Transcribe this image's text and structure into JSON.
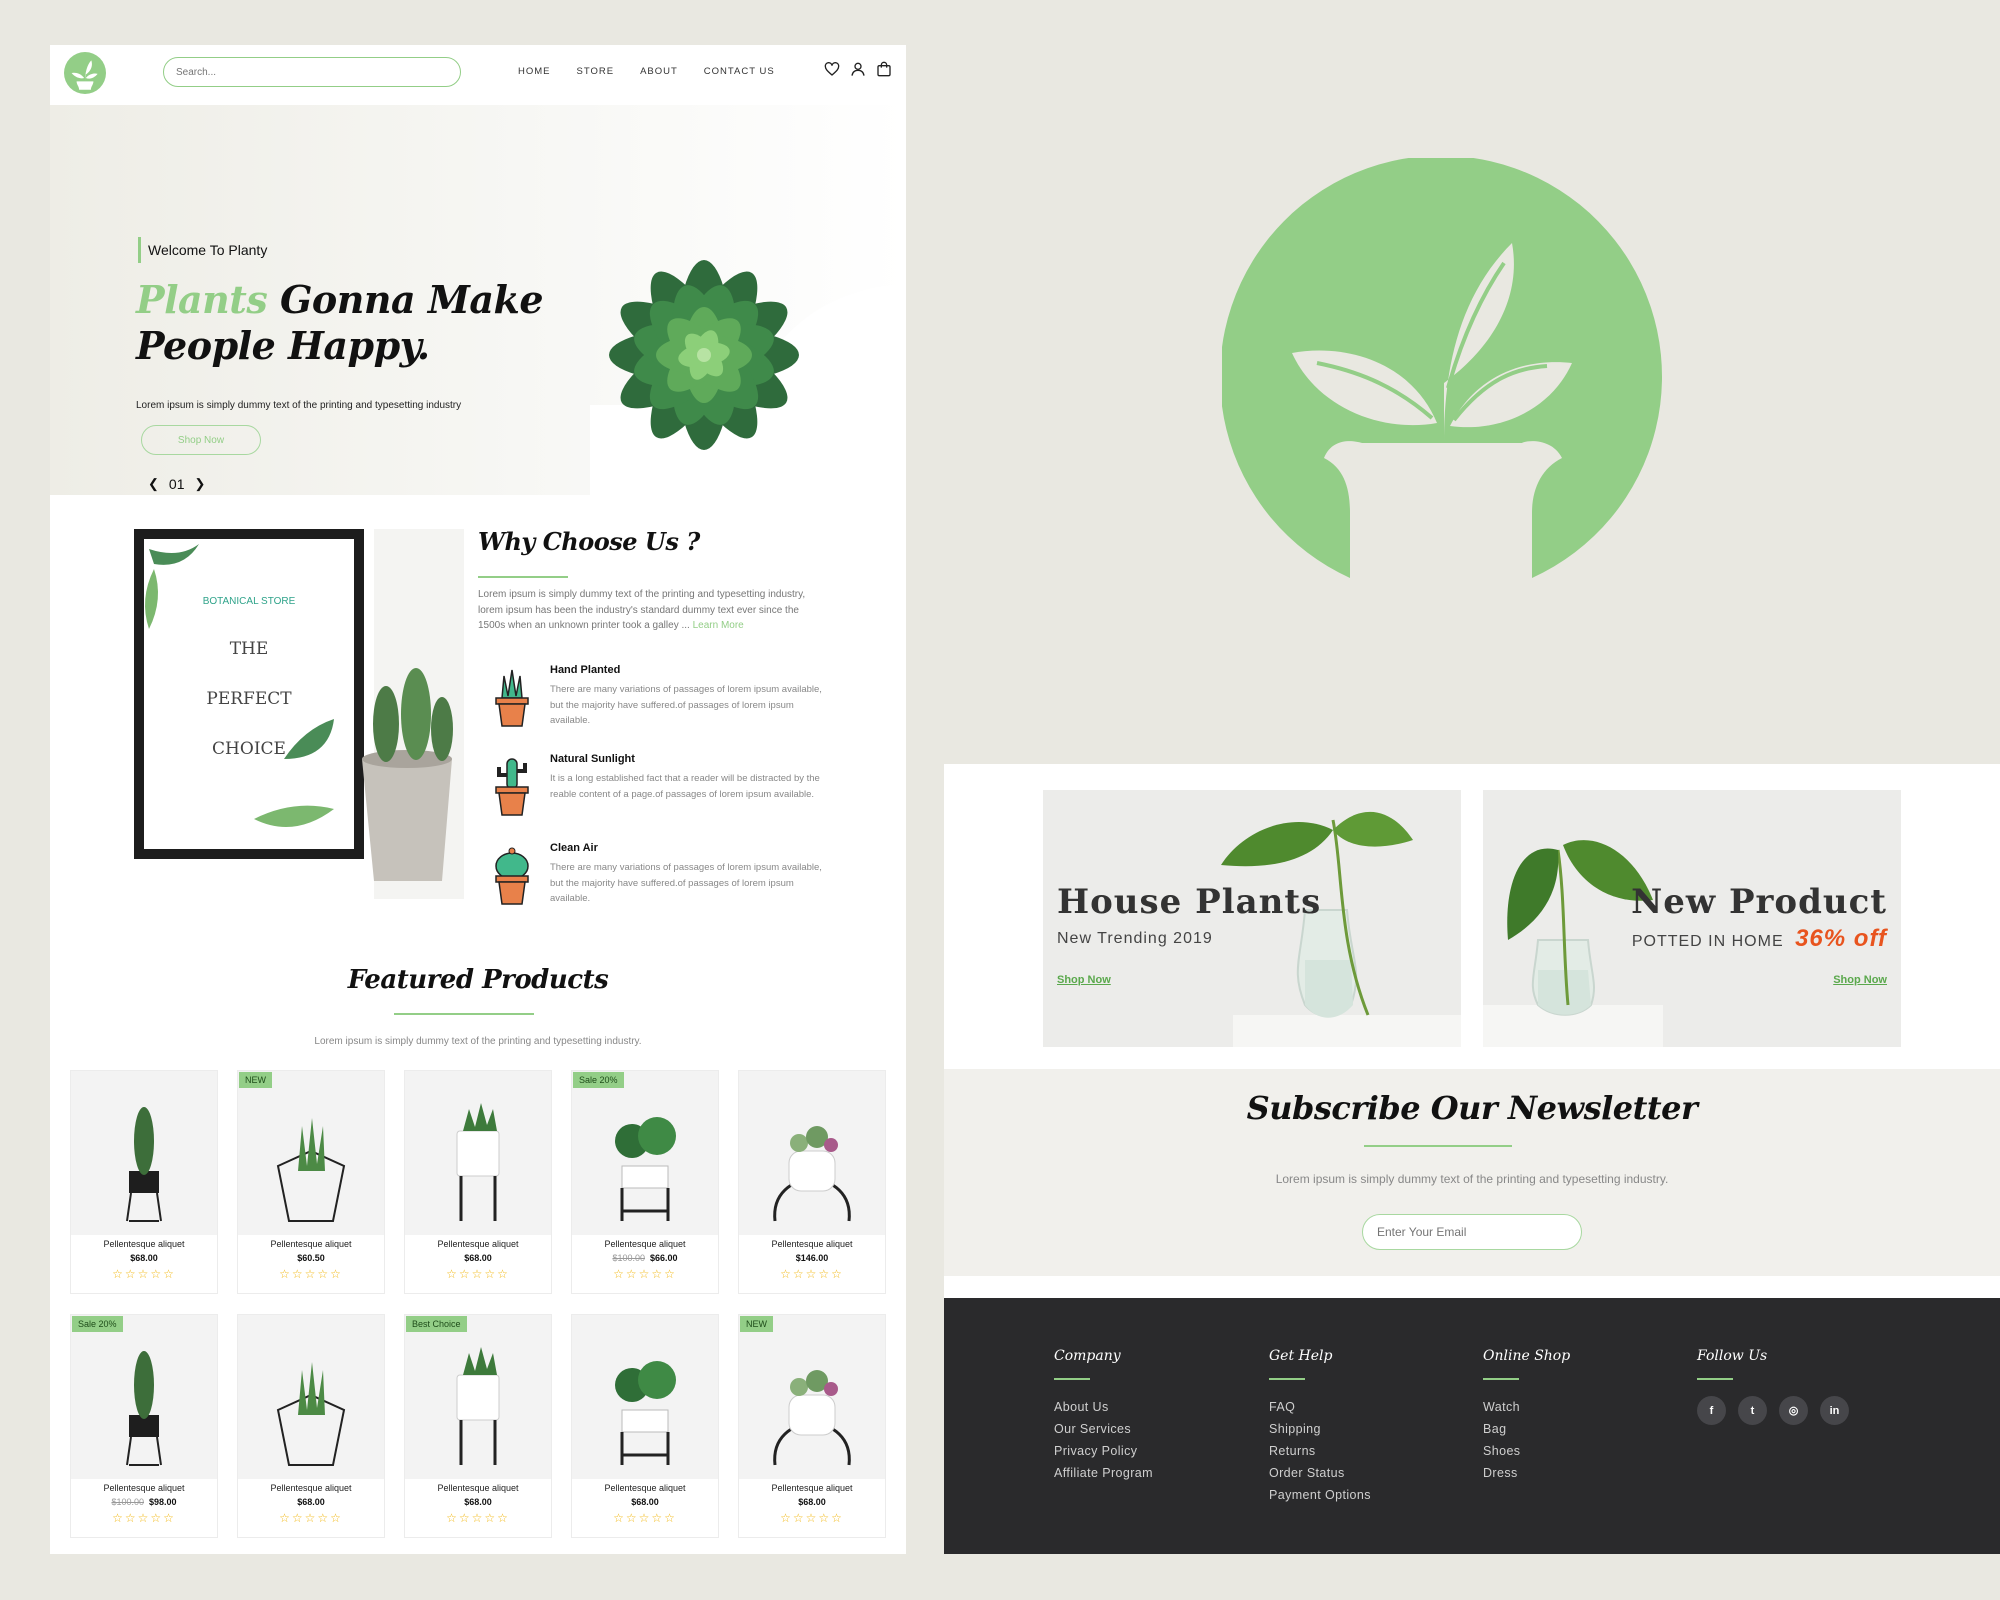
{
  "nav": {
    "search_placeholder": "Search...",
    "links": [
      "HOME",
      "STORE",
      "ABOUT",
      "CONTACT US"
    ],
    "icons": [
      "heart-icon",
      "user-icon",
      "bag-icon"
    ]
  },
  "hero": {
    "eyebrow": "Welcome To Planty",
    "title_highlight": "Plants",
    "title_rest": "Gonna Make",
    "title_line2": "People Happy.",
    "subtitle": "Lorem ipsum is simply dummy text of the printing and typesetting industry",
    "button": "Shop Now",
    "slide": "01"
  },
  "poster": {
    "store_label": "BOTANICAL STORE",
    "line1": "THE",
    "line2": "PERFECT",
    "line3": "CHOICE"
  },
  "why": {
    "title": "Why Choose Us ?",
    "text": "Lorem ipsum is simply dummy text of the printing and typesetting industry, lorem ipsum has been the industry's standard dummy text ever since the 1500s when an unknown printer took a galley ...",
    "link": "Learn More",
    "features": [
      {
        "title": "Hand Planted",
        "text": "There are many variations of passages of lorem ipsum available, but the majority have suffered.of passages of lorem ipsum available."
      },
      {
        "title": "Natural Sunlight",
        "text": "It is a long established fact that a reader will be distracted by the reable content of a page.of passages of lorem ipsum available."
      },
      {
        "title": "Clean Air",
        "text": "There are many variations of passages of lorem ipsum available, but the majority have suffered.of passages of lorem ipsum available."
      }
    ]
  },
  "featured": {
    "title": "Featured Products",
    "subtitle": "Lorem ipsum is simply dummy text of the printing and typesetting industry.",
    "products": [
      {
        "name": "Pellentesque aliquet",
        "price": "$68.00",
        "old": "",
        "badge": "",
        "stars": "☆☆☆☆☆"
      },
      {
        "name": "Pellentesque aliquet",
        "price": "$60.50",
        "old": "",
        "badge": "NEW",
        "stars": "☆☆☆☆☆"
      },
      {
        "name": "Pellentesque aliquet",
        "price": "$68.00",
        "old": "",
        "badge": "",
        "stars": "☆☆☆☆☆"
      },
      {
        "name": "Pellentesque aliquet",
        "price": "$66.00",
        "old": "$100.00",
        "badge": "Sale 20%",
        "stars": "☆☆☆☆☆"
      },
      {
        "name": "Pellentesque aliquet",
        "price": "$146.00",
        "old": "",
        "badge": "",
        "stars": "☆☆☆☆☆"
      },
      {
        "name": "Pellentesque aliquet",
        "price": "$98.00",
        "old": "$100.00",
        "badge": "Sale 20%",
        "stars": "☆☆☆☆☆"
      },
      {
        "name": "Pellentesque aliquet",
        "price": "$68.00",
        "old": "",
        "badge": "",
        "stars": "☆☆☆☆☆"
      },
      {
        "name": "Pellentesque aliquet",
        "price": "$68.00",
        "old": "",
        "badge": "Best Choice",
        "stars": "☆☆☆☆☆"
      },
      {
        "name": "Pellentesque aliquet",
        "price": "$68.00",
        "old": "",
        "badge": "",
        "stars": "☆☆☆☆☆"
      },
      {
        "name": "Pellentesque aliquet",
        "price": "$68.00",
        "old": "",
        "badge": "NEW",
        "stars": "☆☆☆☆☆"
      }
    ]
  },
  "banners": {
    "left": {
      "title": "House Plants",
      "subtitle": "New Trending 2019",
      "link": "Shop Now"
    },
    "right": {
      "title": "New Product",
      "subtitle": "POTTED IN HOME",
      "discount": "36% off",
      "link": "Shop Now"
    }
  },
  "newsletter": {
    "title": "Subscribe Our Newsletter",
    "subtitle": "Lorem ipsum is simply dummy text of the printing and typesetting industry.",
    "placeholder": "Enter Your Email"
  },
  "footer": {
    "company": {
      "title": "Company",
      "links": [
        "About Us",
        "Our Services",
        "Privacy Policy",
        "Affiliate Program"
      ]
    },
    "help": {
      "title": "Get Help",
      "links": [
        "FAQ",
        "Shipping",
        "Returns",
        "Order Status",
        "Payment Options"
      ]
    },
    "shop": {
      "title": "Online Shop",
      "links": [
        "Watch",
        "Bag",
        "Shoes",
        "Dress"
      ]
    },
    "follow": {
      "title": "Follow Us",
      "social": [
        "f",
        "t",
        "◎",
        "in"
      ]
    }
  },
  "colors": {
    "brand_green": "#93ce87",
    "accent_orange": "#e8541e",
    "footer_bg": "#2a2a2c",
    "page_bg": "#e9e8e1"
  }
}
